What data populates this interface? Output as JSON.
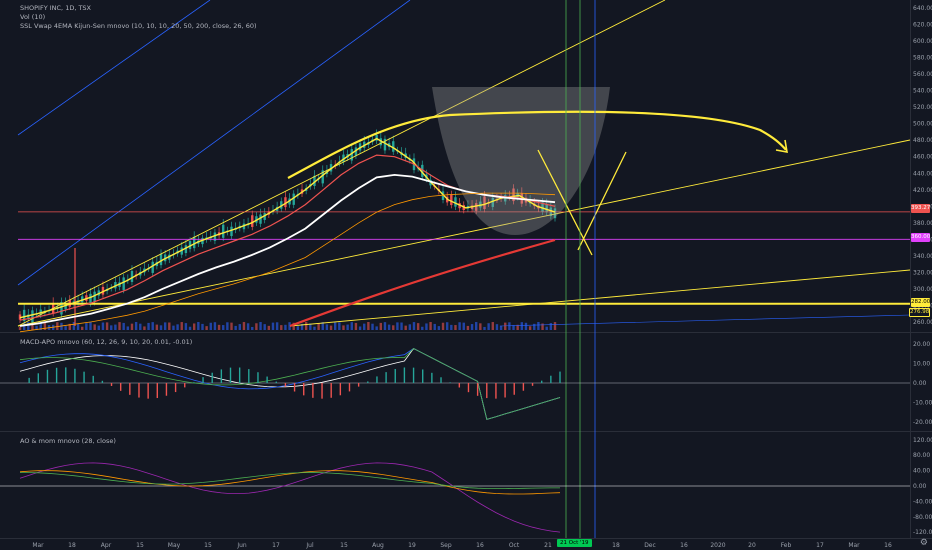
{
  "main_pane": {
    "title": "SHOPIFY INC, 1D, TSX",
    "volume_label": "Vol (10)",
    "indicator_label": "SSL Vwap 4EMA Kijun-Sen mnovo (10, 10, 10, 20, 50, 200, close, 26, 60)"
  },
  "macd_pane": {
    "label": "MACD-APO mnovo (60, 12, 26, 9, 10, 20, 0.01, -0.01)"
  },
  "ao_pane": {
    "label": "AO & mom mnovo (28, close)"
  },
  "price_tags": {
    "last": "393.27",
    "magenta": "360.00",
    "yellow": "282.00",
    "yellow_box": "276.98"
  },
  "bottom_bar": {
    "highlight": "21 Oct '19",
    "settings_icon": "gear-icon"
  },
  "colors": {
    "background": "#131722",
    "up": "#26a69a",
    "down": "#ef5350",
    "yellow": "#ffeb3b",
    "magenta": "#e040fb",
    "green_line": "#4caf50",
    "blue_line": "#2962ff"
  },
  "chart_data": [
    {
      "type": "line",
      "pane": "price",
      "y_axis_ticks": [
        "640.00",
        "620.00",
        "600.00",
        "580.00",
        "560.00",
        "540.00",
        "520.00",
        "500.00",
        "480.00",
        "460.00",
        "440.00",
        "420.00",
        "400.00",
        "380.00",
        "360.00",
        "340.00",
        "320.00",
        "300.00",
        "280.00",
        "260.00"
      ],
      "ylim": [
        255,
        645
      ],
      "x_axis_ticks": [
        "Mar",
        "18",
        "Apr",
        "15",
        "May",
        "15",
        "Jun",
        "17",
        "Jul",
        "15",
        "Aug",
        "19",
        "Sep",
        "16",
        "Oct",
        "21",
        "Nov",
        "18",
        "Dec",
        "16",
        "2020",
        "20",
        "Feb",
        "17",
        "Mar",
        "16"
      ],
      "series": [
        {
          "values": [
            265,
            270,
            276,
            283,
            290,
            300,
            310,
            322,
            335,
            346,
            357,
            365,
            372,
            380,
            392,
            405,
            420,
            438,
            455,
            470,
            482,
            470,
            455,
            430,
            408,
            398,
            402,
            410,
            413,
            400,
            393
          ]
        },
        {
          "values": [
            262,
            266,
            271,
            277,
            283,
            291,
            299,
            310,
            322,
            332,
            342,
            350,
            358,
            366,
            376,
            388,
            402,
            420,
            438,
            452,
            462,
            460,
            452,
            438,
            425,
            418,
            414,
            412,
            410,
            405,
            400
          ]
        },
        {
          "values": [
            255,
            258,
            262,
            266,
            270,
            276,
            282,
            290,
            300,
            309,
            318,
            326,
            333,
            341,
            350,
            361,
            373,
            390,
            407,
            422,
            435,
            438,
            436,
            430,
            424,
            418,
            414,
            411,
            409,
            407,
            405
          ]
        },
        {
          "values": [
            248,
            251,
            254,
            257,
            260,
            264,
            268,
            273,
            280,
            287,
            294,
            300,
            306,
            313,
            320,
            329,
            338,
            352,
            366,
            380,
            393,
            402,
            408,
            412,
            414,
            415,
            416,
            416,
            416,
            415,
            414
          ]
        }
      ],
      "annotations": {
        "horizontal_levels": [
          {
            "value": 393.27
          },
          {
            "value": 360.0
          },
          {
            "value": 282.0
          }
        ],
        "vertical_markers": [
          "Oct 21",
          "Oct 28",
          "Nov 4"
        ]
      }
    },
    {
      "type": "line",
      "pane": "macd",
      "y_axis_ticks": [
        "20.00",
        "10.00",
        "0.00",
        "-10.00",
        "-20.00"
      ],
      "ylim": [
        -24,
        24
      ]
    },
    {
      "type": "line",
      "pane": "ao_mom",
      "y_axis_ticks": [
        "120.00",
        "80.00",
        "40.00",
        "0.00",
        "-40.00",
        "-80.00",
        "-120.00"
      ],
      "ylim": [
        -130,
        130
      ]
    }
  ]
}
